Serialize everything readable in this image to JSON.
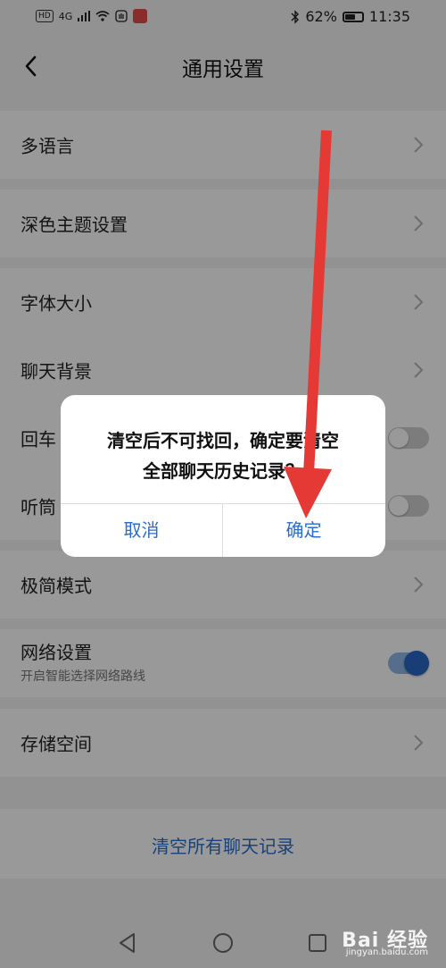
{
  "status_bar": {
    "network_label": "HD",
    "signal_label": "4G",
    "battery_percent_text": "62%",
    "battery_level": 0.62,
    "time": "11:35",
    "bluetooth_icon": "bluetooth-icon"
  },
  "header": {
    "title": "通用设置",
    "back_icon": "back-arrow-icon"
  },
  "settings": {
    "multilang": "多语言",
    "dark_theme": "深色主题设置",
    "font_size": "字体大小",
    "chat_background": "聊天背景",
    "enter_send": "回车",
    "earpiece": "听筒",
    "minimal_mode": "极简模式",
    "network": "网络设置",
    "network_sub": "开启智能选择网络路线",
    "storage": "存储空间"
  },
  "toggles": {
    "enter_send": false,
    "earpiece": false,
    "network": true
  },
  "clear_all_button": "清空所有聊天记录",
  "dialog": {
    "message_line1": "清空后不可找回，确定要清空",
    "message_line2": "全部聊天历史记录？",
    "cancel": "取消",
    "confirm": "确定"
  },
  "watermark": {
    "brand": "Bai 经验",
    "url": "jingyan.baidu.com"
  },
  "colors": {
    "accent_blue": "#2b6dcc",
    "annotation_red": "#e53935"
  }
}
